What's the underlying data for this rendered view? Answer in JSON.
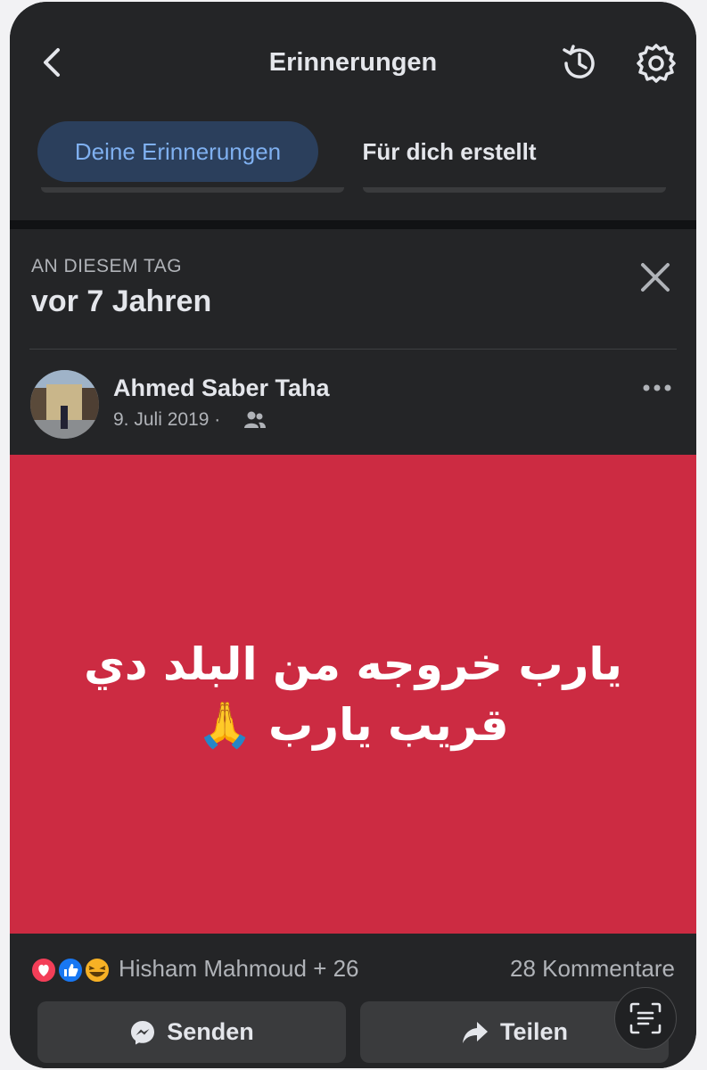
{
  "header": {
    "title": "Erinnerungen",
    "icons": {
      "back": "back-arrow-icon",
      "history": "history-icon",
      "settings": "gear-icon"
    }
  },
  "tabs": [
    {
      "label": "Deine Erinnerungen",
      "active": true
    },
    {
      "label": "Für dich erstellt",
      "active": false
    }
  ],
  "memory": {
    "kicker": "AN DIESEM TAG",
    "heading": "vor 7 Jahren"
  },
  "post": {
    "author": "Ahmed Saber Taha",
    "date": "9. Juli 2019 ·",
    "audience_icon": "friends-icon",
    "background_color": "#cc2b42",
    "text_line1": "يارب خروجه من البلد دي",
    "text_line2": "قريب يارب 🙏"
  },
  "engagement": {
    "reactions": [
      "love",
      "like",
      "haha"
    ],
    "reactors_text": "Hisham Mahmoud + 26",
    "comments_text": "28 Kommentare"
  },
  "actions": {
    "send_label": "Senden",
    "share_label": "Teilen"
  },
  "colors": {
    "background": "#242527",
    "accent": "#7fb0f0",
    "post_bg": "#cc2b42"
  }
}
